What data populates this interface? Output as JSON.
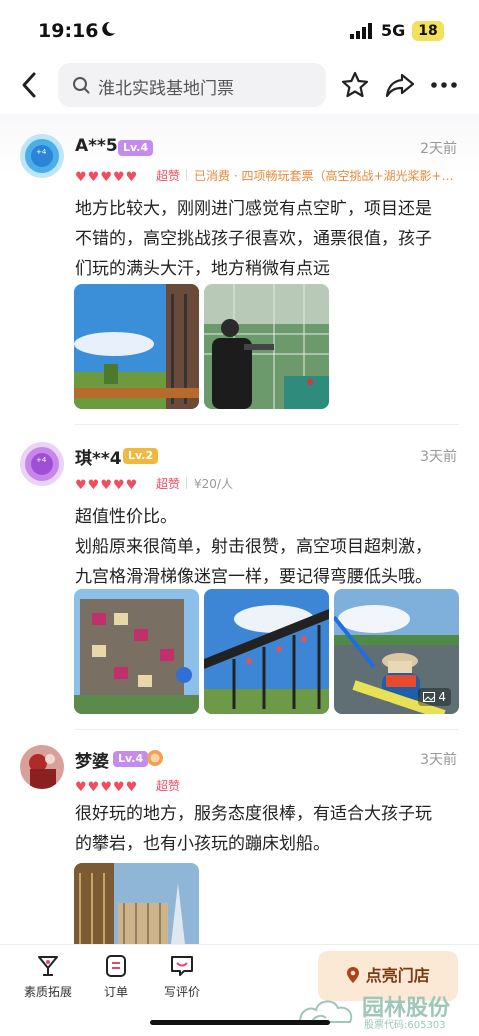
{
  "status": {
    "time": "19:16",
    "network": "5G",
    "battery": "18"
  },
  "nav": {
    "search_text": "淮北实践基地门票"
  },
  "reviews": [
    {
      "user": "A**5",
      "level": "Lv.4",
      "level_color": "#c58cf0",
      "time": "2天前",
      "praise": "超赞",
      "meta": "已消费 · 四项畅玩套票（高空挑战+湖光桨影+…",
      "text_lines": [
        "地方比较大，刚刚进门感觉有点空旷，项目还是",
        "不错的，高空挑战孩子很喜欢，通票很值，孩子",
        "们玩的满头大汗，地方稍微有点远"
      ]
    },
    {
      "user": "琪**4",
      "level": "Lv.2",
      "level_color": "#f0b93d",
      "time": "3天前",
      "praise": "超赞",
      "meta": "¥20/人",
      "text_lines": [
        "超值性价比。",
        "划船原来很简单，射击很赞，高空项目超刺激，",
        "九宫格滑滑梯像迷宫一样，要记得弯腰低头哦。"
      ],
      "photo_count": "4"
    },
    {
      "user": "梦婆",
      "level": "Lv.4",
      "level_color": "#c58cf0",
      "time": "3天前",
      "praise": "超赞",
      "text_lines": [
        "很好玩的地方，服务态度很棒，有适合大孩子玩",
        "的攀岩，也有小孩玩的蹦床划船。"
      ]
    }
  ],
  "bottom": {
    "tool1": "素质拓展",
    "tool2": "订单",
    "tool3": "写评价",
    "light_button": "点亮门店"
  },
  "watermark": {
    "name": "园林股份",
    "code": "股票代码:605303"
  }
}
